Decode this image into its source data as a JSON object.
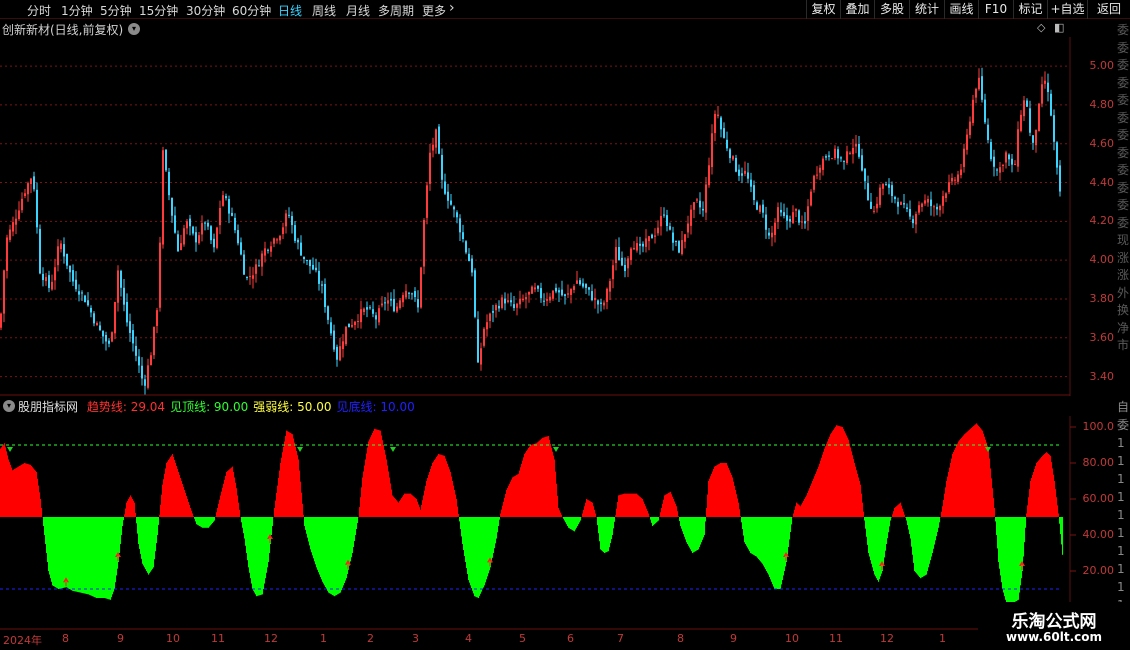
{
  "toolbar": {
    "periods": [
      {
        "label": "分时",
        "active": false
      },
      {
        "label": "1分钟",
        "active": false
      },
      {
        "label": "5分钟",
        "active": false
      },
      {
        "label": "15分钟",
        "active": false
      },
      {
        "label": "30分钟",
        "active": false
      },
      {
        "label": "60分钟",
        "active": false
      },
      {
        "label": "日线",
        "active": true
      },
      {
        "label": "周线",
        "active": false
      },
      {
        "label": "月线",
        "active": false
      },
      {
        "label": "多周期",
        "active": false
      },
      {
        "label": "更多",
        "active": false
      }
    ],
    "more_chevron_icon": "chevron-right-icon",
    "actions": [
      "复权",
      "叠加",
      "多股",
      "统计",
      "画线",
      "F10",
      "标记",
      "+自选",
      "返回"
    ]
  },
  "main_chart": {
    "title": "创新新材(日线,前复权)",
    "y_ticks": [
      "5.00",
      "4.80",
      "4.60",
      "4.40",
      "4.20",
      "4.00",
      "3.80",
      "3.60",
      "3.40"
    ],
    "icons": [
      "chevron-down-icon",
      "diamond-icon",
      "window-icon"
    ]
  },
  "indicator": {
    "name": "股朋指标网",
    "lines": [
      {
        "label": "趋势线: 29.04",
        "color": "#ff3030"
      },
      {
        "label": "见顶线: 90.00",
        "color": "#30ff30"
      },
      {
        "label": "强弱线: 50.00",
        "color": "#ffff40"
      },
      {
        "label": "见底线: 10.00",
        "color": "#2020ff"
      }
    ],
    "y_ticks": [
      "100.0",
      "80.00",
      "60.00",
      "40.00",
      "20.00"
    ]
  },
  "x_axis": {
    "labels": [
      "2024年",
      "8",
      "9",
      "10",
      "11",
      "12",
      "1",
      "2",
      "3",
      "4",
      "5",
      "6",
      "7",
      "8",
      "9",
      "10",
      "11",
      "12",
      "1"
    ]
  },
  "watermark": {
    "title": "乐淘公式网",
    "url": "www.60lt.com"
  },
  "right_strip": {
    "text": "委委委委委委委委委委委委现涨涨外换净市",
    "text2": "自委1111111111"
  },
  "colors": {
    "up": "#ff3a3a",
    "down": "#3ad4ff",
    "trend_above": "#ff0000",
    "trend_below": "#00ff00",
    "top_line": "#30ff30",
    "bottom_line": "#2020ff",
    "grid": "#7a1414"
  },
  "chart_data": [
    {
      "type": "candlestick",
      "title": "创新新材(日线,前复权)",
      "ylim": [
        3.3,
        5.15
      ],
      "close_path": [
        [
          0,
          3.65
        ],
        [
          6,
          4.1
        ],
        [
          14,
          4.2
        ],
        [
          24,
          4.35
        ],
        [
          33,
          4.45
        ],
        [
          40,
          3.95
        ],
        [
          50,
          3.85
        ],
        [
          60,
          4.1
        ],
        [
          72,
          3.9
        ],
        [
          85,
          3.8
        ],
        [
          98,
          3.65
        ],
        [
          110,
          3.55
        ],
        [
          118,
          3.95
        ],
        [
          126,
          3.7
        ],
        [
          134,
          3.55
        ],
        [
          144,
          3.35
        ],
        [
          152,
          3.55
        ],
        [
          158,
          3.8
        ],
        [
          163,
          4.55
        ],
        [
          170,
          4.3
        ],
        [
          178,
          4.05
        ],
        [
          186,
          4.2
        ],
        [
          195,
          4.1
        ],
        [
          205,
          4.2
        ],
        [
          214,
          4.05
        ],
        [
          222,
          4.35
        ],
        [
          230,
          4.25
        ],
        [
          238,
          4.1
        ],
        [
          246,
          3.9
        ],
        [
          255,
          3.95
        ],
        [
          264,
          4.05
        ],
        [
          272,
          4.1
        ],
        [
          281,
          4.15
        ],
        [
          288,
          4.25
        ],
        [
          296,
          4.1
        ],
        [
          305,
          4.0
        ],
        [
          314,
          3.95
        ],
        [
          322,
          3.85
        ],
        [
          330,
          3.65
        ],
        [
          337,
          3.5
        ],
        [
          346,
          3.65
        ],
        [
          356,
          3.7
        ],
        [
          366,
          3.75
        ],
        [
          376,
          3.7
        ],
        [
          386,
          3.8
        ],
        [
          396,
          3.75
        ],
        [
          404,
          3.85
        ],
        [
          411,
          3.85
        ],
        [
          418,
          3.75
        ],
        [
          424,
          4.2
        ],
        [
          430,
          4.55
        ],
        [
          436,
          4.65
        ],
        [
          442,
          4.4
        ],
        [
          450,
          4.3
        ],
        [
          458,
          4.2
        ],
        [
          466,
          4.05
        ],
        [
          472,
          3.95
        ],
        [
          478,
          3.45
        ],
        [
          484,
          3.65
        ],
        [
          494,
          3.75
        ],
        [
          504,
          3.8
        ],
        [
          514,
          3.75
        ],
        [
          524,
          3.8
        ],
        [
          534,
          3.85
        ],
        [
          544,
          3.8
        ],
        [
          556,
          3.85
        ],
        [
          566,
          3.8
        ],
        [
          576,
          3.9
        ],
        [
          586,
          3.85
        ],
        [
          594,
          3.8
        ],
        [
          602,
          3.75
        ],
        [
          608,
          3.85
        ],
        [
          616,
          4.05
        ],
        [
          624,
          3.95
        ],
        [
          632,
          4.1
        ],
        [
          640,
          4.05
        ],
        [
          648,
          4.1
        ],
        [
          656,
          4.15
        ],
        [
          664,
          4.25
        ],
        [
          672,
          4.1
        ],
        [
          680,
          4.05
        ],
        [
          688,
          4.2
        ],
        [
          696,
          4.3
        ],
        [
          703,
          4.25
        ],
        [
          710,
          4.55
        ],
        [
          716,
          4.8
        ],
        [
          722,
          4.65
        ],
        [
          730,
          4.55
        ],
        [
          738,
          4.45
        ],
        [
          746,
          4.45
        ],
        [
          754,
          4.3
        ],
        [
          762,
          4.25
        ],
        [
          770,
          4.1
        ],
        [
          778,
          4.25
        ],
        [
          786,
          4.2
        ],
        [
          796,
          4.25
        ],
        [
          804,
          4.15
        ],
        [
          812,
          4.4
        ],
        [
          820,
          4.5
        ],
        [
          828,
          4.55
        ],
        [
          836,
          4.55
        ],
        [
          844,
          4.5
        ],
        [
          852,
          4.6
        ],
        [
          860,
          4.55
        ],
        [
          866,
          4.35
        ],
        [
          874,
          4.25
        ],
        [
          882,
          4.4
        ],
        [
          890,
          4.35
        ],
        [
          898,
          4.3
        ],
        [
          906,
          4.25
        ],
        [
          912,
          4.2
        ],
        [
          920,
          4.3
        ],
        [
          928,
          4.3
        ],
        [
          936,
          4.25
        ],
        [
          944,
          4.35
        ],
        [
          952,
          4.4
        ],
        [
          960,
          4.45
        ],
        [
          966,
          4.6
        ],
        [
          972,
          4.8
        ],
        [
          978,
          4.95
        ],
        [
          984,
          4.75
        ],
        [
          990,
          4.55
        ],
        [
          998,
          4.45
        ],
        [
          1006,
          4.55
        ],
        [
          1014,
          4.45
        ],
        [
          1020,
          4.75
        ],
        [
          1026,
          4.85
        ],
        [
          1032,
          4.55
        ],
        [
          1038,
          4.75
        ],
        [
          1044,
          4.95
        ],
        [
          1050,
          4.8
        ],
        [
          1056,
          4.5
        ],
        [
          1062,
          4.25
        ]
      ]
    },
    {
      "type": "area",
      "name": "股朋指标网",
      "ylim": [
        0,
        110
      ],
      "reference_lines": {
        "见顶线": 90.0,
        "强弱线": 50.0,
        "见底线": 10.0
      },
      "last_value": 29.04,
      "trend_path": [
        [
          0,
          88
        ],
        [
          4,
          91
        ],
        [
          8,
          82
        ],
        [
          12,
          76
        ],
        [
          18,
          78
        ],
        [
          24,
          80
        ],
        [
          30,
          79
        ],
        [
          36,
          75
        ],
        [
          40,
          60
        ],
        [
          44,
          40
        ],
        [
          48,
          20
        ],
        [
          52,
          12
        ],
        [
          58,
          10
        ],
        [
          66,
          11
        ],
        [
          72,
          9
        ],
        [
          80,
          8
        ],
        [
          88,
          7
        ],
        [
          96,
          5
        ],
        [
          104,
          5
        ],
        [
          110,
          4
        ],
        [
          114,
          10
        ],
        [
          118,
          25
        ],
        [
          122,
          45
        ],
        [
          126,
          58
        ],
        [
          130,
          62
        ],
        [
          134,
          58
        ],
        [
          138,
          35
        ],
        [
          142,
          24
        ],
        [
          148,
          18
        ],
        [
          153,
          22
        ],
        [
          157,
          40
        ],
        [
          162,
          68
        ],
        [
          166,
          80
        ],
        [
          172,
          85
        ],
        [
          178,
          75
        ],
        [
          184,
          65
        ],
        [
          190,
          55
        ],
        [
          196,
          46
        ],
        [
          202,
          44
        ],
        [
          208,
          44
        ],
        [
          214,
          48
        ],
        [
          220,
          62
        ],
        [
          226,
          75
        ],
        [
          232,
          78
        ],
        [
          236,
          66
        ],
        [
          240,
          50
        ],
        [
          244,
          38
        ],
        [
          248,
          22
        ],
        [
          252,
          10
        ],
        [
          256,
          6
        ],
        [
          262,
          7
        ],
        [
          268,
          25
        ],
        [
          274,
          55
        ],
        [
          280,
          80
        ],
        [
          286,
          98
        ],
        [
          292,
          96
        ],
        [
          298,
          82
        ],
        [
          304,
          45
        ],
        [
          310,
          32
        ],
        [
          316,
          22
        ],
        [
          322,
          14
        ],
        [
          328,
          8
        ],
        [
          334,
          6
        ],
        [
          340,
          8
        ],
        [
          346,
          16
        ],
        [
          352,
          30
        ],
        [
          358,
          50
        ],
        [
          362,
          72
        ],
        [
          368,
          92
        ],
        [
          374,
          99
        ],
        [
          380,
          98
        ],
        [
          386,
          82
        ],
        [
          392,
          62
        ],
        [
          398,
          58
        ],
        [
          404,
          63
        ],
        [
          410,
          63
        ],
        [
          416,
          60
        ],
        [
          420,
          54
        ],
        [
          426,
          70
        ],
        [
          432,
          80
        ],
        [
          438,
          85
        ],
        [
          444,
          84
        ],
        [
          450,
          75
        ],
        [
          456,
          60
        ],
        [
          462,
          35
        ],
        [
          468,
          15
        ],
        [
          474,
          6
        ],
        [
          478,
          5
        ],
        [
          484,
          12
        ],
        [
          490,
          22
        ],
        [
          496,
          38
        ],
        [
          500,
          52
        ],
        [
          506,
          65
        ],
        [
          512,
          72
        ],
        [
          518,
          74
        ],
        [
          524,
          85
        ],
        [
          530,
          90
        ],
        [
          536,
          91
        ],
        [
          542,
          94
        ],
        [
          548,
          95
        ],
        [
          554,
          82
        ],
        [
          558,
          55
        ],
        [
          562,
          50
        ],
        [
          568,
          44
        ],
        [
          574,
          42
        ],
        [
          580,
          48
        ],
        [
          586,
          60
        ],
        [
          592,
          58
        ],
        [
          596,
          50
        ],
        [
          600,
          32
        ],
        [
          604,
          30
        ],
        [
          608,
          31
        ],
        [
          612,
          40
        ],
        [
          618,
          62
        ],
        [
          624,
          63
        ],
        [
          630,
          63
        ],
        [
          636,
          63
        ],
        [
          642,
          60
        ],
        [
          648,
          52
        ],
        [
          652,
          45
        ],
        [
          658,
          48
        ],
        [
          664,
          62
        ],
        [
          670,
          64
        ],
        [
          676,
          56
        ],
        [
          680,
          45
        ],
        [
          686,
          36
        ],
        [
          692,
          30
        ],
        [
          698,
          32
        ],
        [
          704,
          40
        ],
        [
          708,
          70
        ],
        [
          714,
          78
        ],
        [
          720,
          80
        ],
        [
          726,
          80
        ],
        [
          732,
          72
        ],
        [
          738,
          58
        ],
        [
          744,
          36
        ],
        [
          750,
          30
        ],
        [
          756,
          28
        ],
        [
          762,
          24
        ],
        [
          768,
          18
        ],
        [
          774,
          10
        ],
        [
          780,
          10
        ],
        [
          786,
          25
        ],
        [
          792,
          50
        ],
        [
          796,
          58
        ],
        [
          800,
          56
        ],
        [
          806,
          62
        ],
        [
          812,
          70
        ],
        [
          818,
          78
        ],
        [
          824,
          88
        ],
        [
          830,
          96
        ],
        [
          836,
          101
        ],
        [
          842,
          100
        ],
        [
          848,
          93
        ],
        [
          854,
          80
        ],
        [
          860,
          68
        ],
        [
          864,
          48
        ],
        [
          868,
          30
        ],
        [
          874,
          18
        ],
        [
          878,
          14
        ],
        [
          882,
          20
        ],
        [
          886,
          35
        ],
        [
          890,
          48
        ],
        [
          894,
          55
        ],
        [
          900,
          58
        ],
        [
          906,
          48
        ],
        [
          910,
          38
        ],
        [
          914,
          20
        ],
        [
          920,
          16
        ],
        [
          926,
          18
        ],
        [
          932,
          30
        ],
        [
          938,
          44
        ],
        [
          942,
          56
        ],
        [
          946,
          70
        ],
        [
          952,
          85
        ],
        [
          958,
          92
        ],
        [
          964,
          96
        ],
        [
          970,
          99
        ],
        [
          976,
          102
        ],
        [
          982,
          98
        ],
        [
          988,
          88
        ],
        [
          994,
          55
        ],
        [
          998,
          25
        ],
        [
          1002,
          10
        ],
        [
          1006,
          2
        ],
        [
          1012,
          2
        ],
        [
          1018,
          4
        ],
        [
          1022,
          20
        ],
        [
          1026,
          52
        ],
        [
          1030,
          70
        ],
        [
          1036,
          80
        ],
        [
          1042,
          84
        ],
        [
          1046,
          86
        ],
        [
          1050,
          84
        ],
        [
          1054,
          70
        ],
        [
          1058,
          52
        ],
        [
          1062,
          29
        ]
      ],
      "arrows_up": [
        66,
        118,
        270,
        348,
        490,
        786,
        882,
        1022
      ],
      "arrows_down": [
        10,
        300,
        393,
        556,
        988
      ]
    }
  ]
}
